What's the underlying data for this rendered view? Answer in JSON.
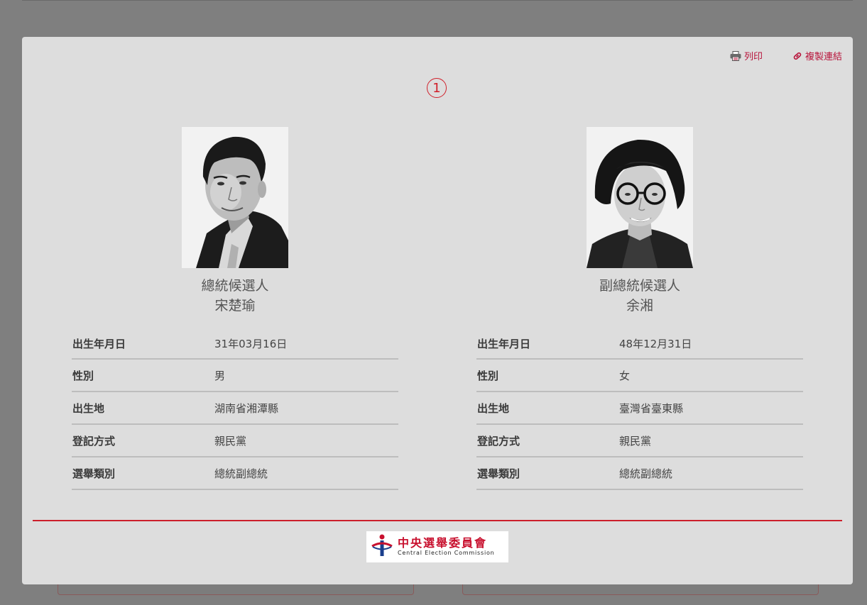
{
  "toolbar": {
    "print_label": "列印",
    "copy_link_label": "複製連結",
    "print_icon": "printer-icon",
    "copy_link_icon": "link-icon",
    "accent_color": "#b8143b"
  },
  "candidate_number": "1",
  "president": {
    "role": "總統候選人",
    "name": "宋楚瑜",
    "rows": [
      {
        "label": "出生年月日",
        "value": "31年03月16日"
      },
      {
        "label": "性別",
        "value": "男"
      },
      {
        "label": "出生地",
        "value": "湖南省湘潭縣"
      },
      {
        "label": "登記方式",
        "value": "親民黨"
      },
      {
        "label": "選舉類別",
        "value": "總統副總統"
      }
    ]
  },
  "vice_president": {
    "role": "副總統候選人",
    "name": "余湘",
    "rows": [
      {
        "label": "出生年月日",
        "value": "48年12月31日"
      },
      {
        "label": "性別",
        "value": "女"
      },
      {
        "label": "出生地",
        "value": "臺灣省臺東縣"
      },
      {
        "label": "登記方式",
        "value": "親民黨"
      },
      {
        "label": "選舉類別",
        "value": "總統副總統"
      }
    ]
  },
  "footer": {
    "logo_cn": "中央選舉委員會",
    "logo_en": "Central Election Commission",
    "divider_color": "#cc1f2b"
  }
}
